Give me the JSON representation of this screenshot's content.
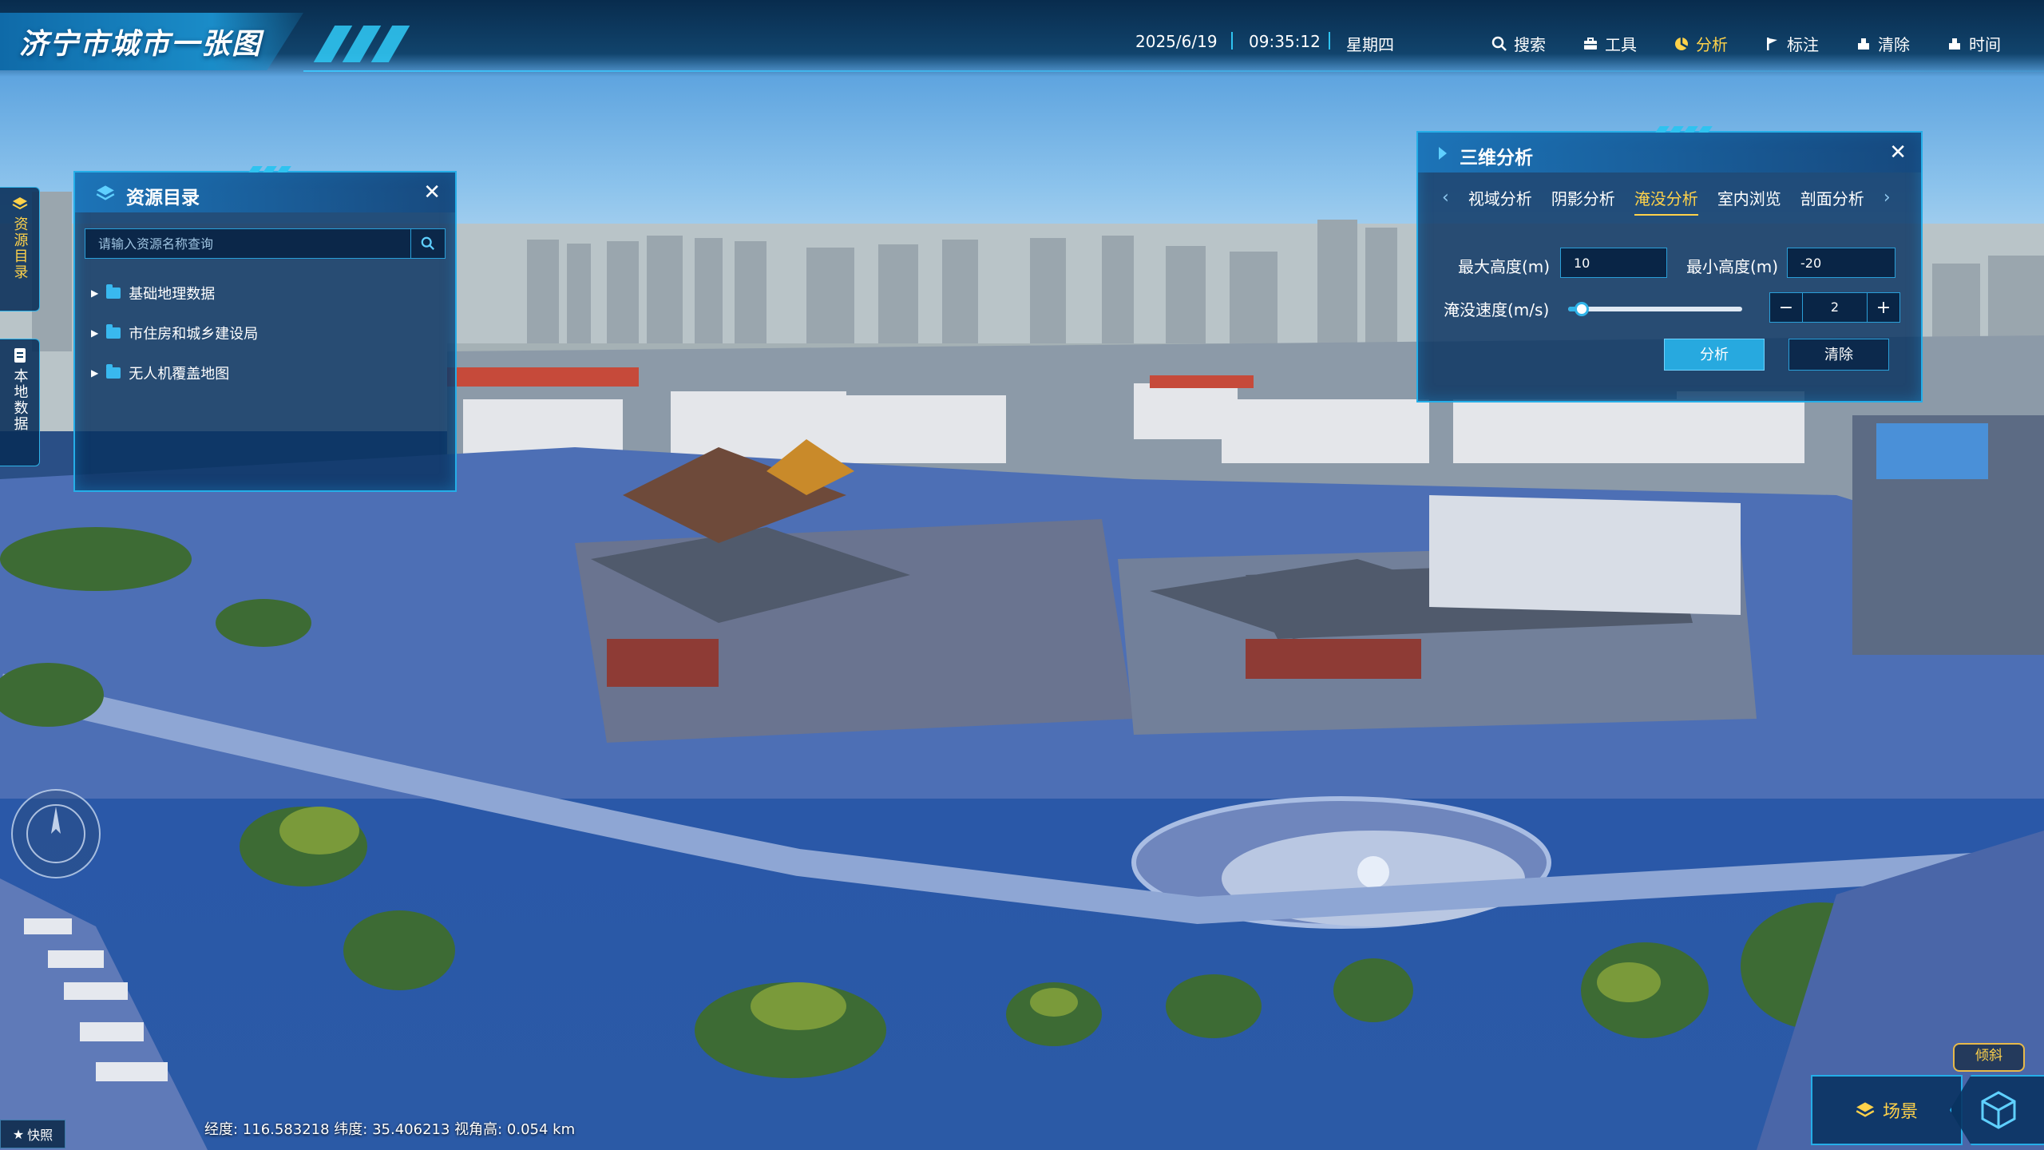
{
  "header": {
    "title": "济宁市城市一张图",
    "date": "2025/6/19",
    "time": "09:35:12",
    "weekday": "星期四"
  },
  "nav": [
    {
      "label": "搜索",
      "icon": "search-icon",
      "active": false
    },
    {
      "label": "工具",
      "icon": "toolbox-icon",
      "active": false
    },
    {
      "label": "分析",
      "icon": "analysis-icon",
      "active": true
    },
    {
      "label": "标注",
      "icon": "flag-icon",
      "active": false
    },
    {
      "label": "清除",
      "icon": "eraser-icon",
      "active": false
    },
    {
      "label": "时间",
      "icon": "clock-icon",
      "active": false
    }
  ],
  "sidebar": {
    "tabs": [
      {
        "label": "资源目录",
        "icon": "layers-icon"
      },
      {
        "label": "本地数据",
        "icon": "file-icon"
      }
    ]
  },
  "resource_panel": {
    "title": "资源目录",
    "search_placeholder": "请输入资源名称查询",
    "items": [
      {
        "label": "基础地理数据"
      },
      {
        "label": "市住房和城乡建设局"
      },
      {
        "label": "无人机覆盖地图"
      }
    ]
  },
  "analysis_panel": {
    "title": "三维分析",
    "tabs": [
      "视域分析",
      "阴影分析",
      "淹没分析",
      "室内浏览",
      "剖面分析"
    ],
    "active_tab": "淹没分析",
    "max_height_label": "最大高度(m)",
    "max_height_value": "10",
    "min_height_label": "最小高度(m)",
    "min_height_value": "-20",
    "speed_label": "淹没速度(m/s)",
    "speed_value": "2",
    "speed_slider_fraction": 0.08,
    "analyze_button": "分析",
    "clear_button": "清除"
  },
  "footer": {
    "snapshot_label": "快照",
    "status_text": "经度: 116.583218 纬度: 35.406213 视角高: 0.054 km",
    "tilt_label": "倾斜",
    "scene_label": "场景"
  },
  "colors": {
    "accent": "#25aee8",
    "active": "#ffd24a",
    "panel_bg": "#083260",
    "flood_water": "#2f62b6"
  }
}
